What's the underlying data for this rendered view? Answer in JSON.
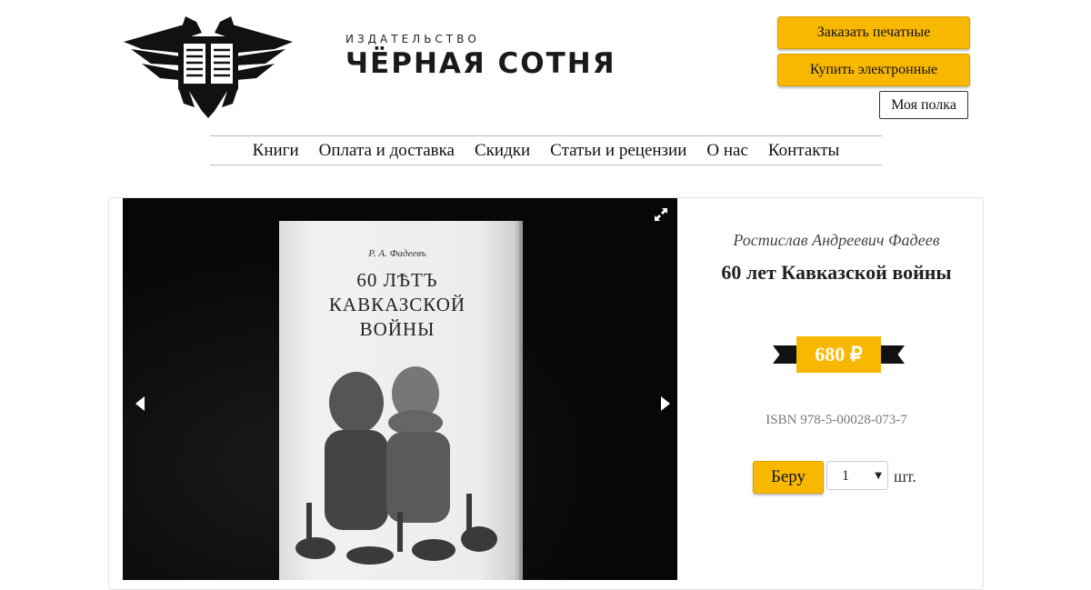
{
  "header": {
    "publisher_label": "ИЗДАТЕЛЬСТВО",
    "publisher_name": "ЧЁРНАЯ СОТНЯ",
    "order_print_label": "Заказать печатные",
    "buy_electronic_label": "Купить электронные",
    "my_shelf_label": "Моя полка",
    "logo_icon": "eagle-book-icon"
  },
  "nav": {
    "items": [
      "Книги",
      "Оплата и доставка",
      "Скидки",
      "Статьи и рецензии",
      "О нас",
      "Контакты"
    ]
  },
  "product": {
    "author": "Ростислав Андреевич Фадеев",
    "title": "60 лет Кавказской войны",
    "price": "680 ₽",
    "isbn": "ISBN 978-5-00028-073-7",
    "take_label": "Беру",
    "quantity": "1",
    "unit": "шт.",
    "cover": {
      "author": "Р. А. Фадеевъ",
      "title_line1": "60 ЛѢТЪ",
      "title_line2": "КАВКАЗСКОЙ",
      "title_line3": "ВОЙНЫ"
    }
  },
  "colors": {
    "accent": "#f9b800",
    "dark": "#111111"
  }
}
